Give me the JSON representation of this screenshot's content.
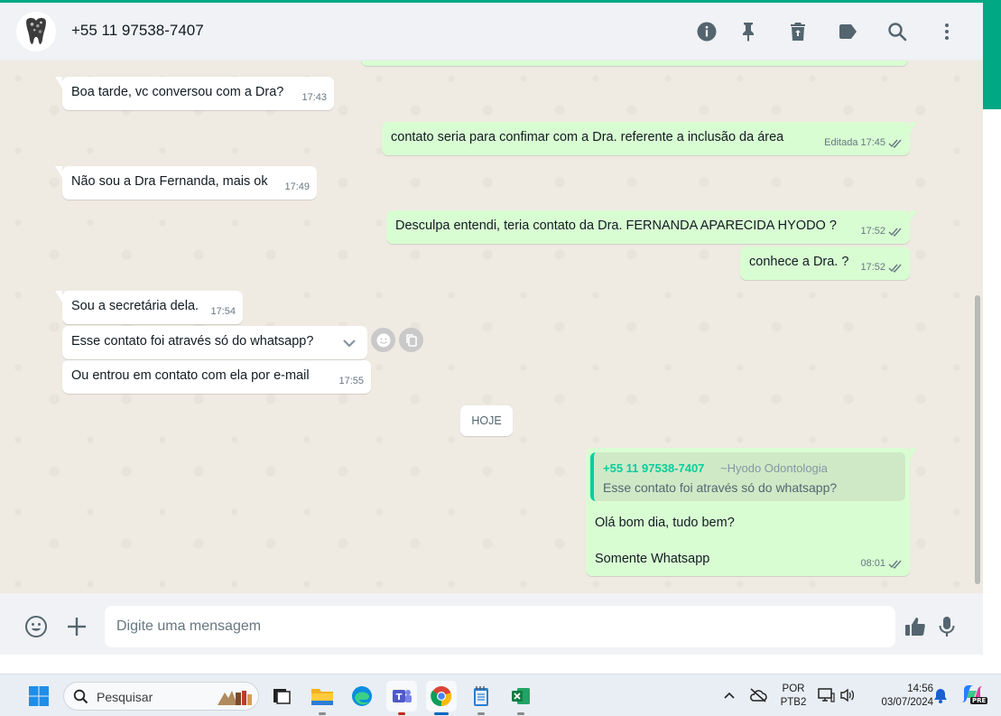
{
  "header": {
    "contact_name": "+55 11 97538-7407",
    "icons": [
      "info-icon",
      "pin-icon",
      "delete-icon",
      "label-icon",
      "search-icon",
      "menu-icon"
    ]
  },
  "messages": [
    {
      "dir": "in",
      "text": "Boa tarde, vc conversou com a Dra?",
      "time": "17:43"
    },
    {
      "dir": "out",
      "text": "contato seria para confimar com a Dra. referente a inclusão da área",
      "edited": "Editada",
      "time": "17:45"
    },
    {
      "dir": "in",
      "text": "Não sou a Dra Fernanda, mais ok",
      "time": "17:49"
    },
    {
      "dir": "out",
      "text": "Desculpa entendi, teria contato da Dra. FERNANDA APARECIDA HYODO ?",
      "time": "17:52"
    },
    {
      "dir": "out",
      "text": "conhece a Dra. ?",
      "time": "17:52"
    },
    {
      "dir": "in",
      "text": "Sou a secretária dela.",
      "time": "17:54"
    },
    {
      "dir": "in",
      "text": "Esse contato foi através só do whatsapp?",
      "time": ""
    },
    {
      "dir": "in",
      "text": "Ou entrou em contato com ela por e-mail",
      "time": "17:55"
    }
  ],
  "date_divider": "HOJE",
  "reply": {
    "quoted_author": "+55 11 97538-7407",
    "quoted_pushname": "~Hyodo Odontologia",
    "quoted_text": "Esse contato foi através só do whatsapp?",
    "line1": "Olá bom dia, tudo bem?",
    "line2": "Somente Whatsapp",
    "time": "08:01"
  },
  "composer": {
    "placeholder": "Digite uma mensagem"
  },
  "taskbar": {
    "search_label": "Pesquisar",
    "lang_line1": "POR",
    "lang_line2": "PTB2",
    "time": "14:56",
    "date": "03/07/2024",
    "copilot_badge": "PRE"
  },
  "colors": {
    "accent": "#00a884",
    "outgoing_bubble": "#d9fdd3",
    "incoming_bubble": "#ffffff",
    "chat_background": "#efeae2"
  }
}
